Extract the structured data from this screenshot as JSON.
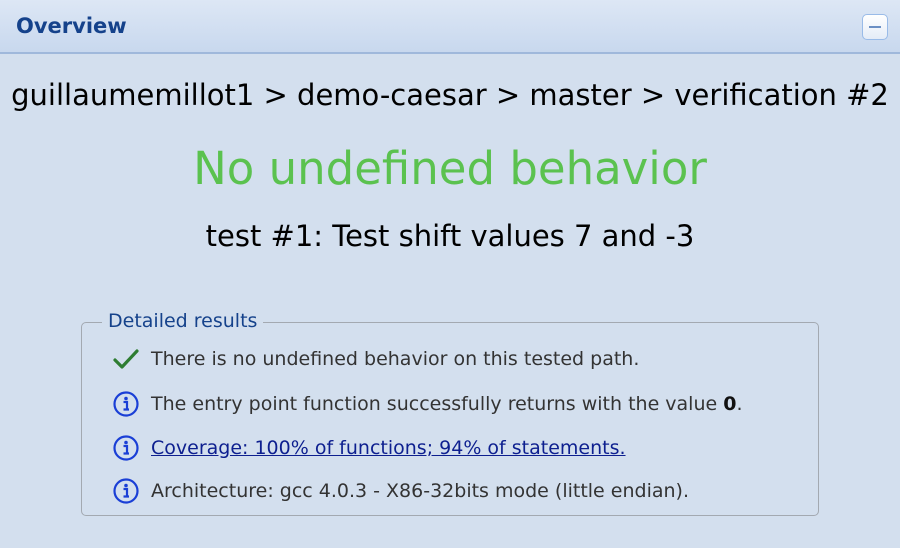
{
  "panel": {
    "title": "Overview"
  },
  "breadcrumb": "guillaumemillot1 > demo-caesar > master > verification #2",
  "status": {
    "text": "No undefined behavior",
    "color": "#5bc24f"
  },
  "test_name": "test #1: Test shift values 7 and -3",
  "details": {
    "legend": "Detailed results",
    "items": [
      {
        "icon": "check-icon",
        "text": "There is no undefined behavior on this tested path."
      },
      {
        "icon": "info-icon",
        "text_before": "The entry point function successfully returns with the value ",
        "value": "0",
        "text_after": "."
      },
      {
        "icon": "info-icon",
        "text": "Coverage: 100% of functions; 94% of statements."
      },
      {
        "icon": "info-icon",
        "text": "Architecture: gcc 4.0.3 - X86-32bits mode (little endian)."
      }
    ]
  },
  "colors": {
    "header_text": "#15428b",
    "background": "#d3dfee",
    "link": "#0d1f8f",
    "check": "#2e7d32",
    "info": "#1a3fd6"
  }
}
